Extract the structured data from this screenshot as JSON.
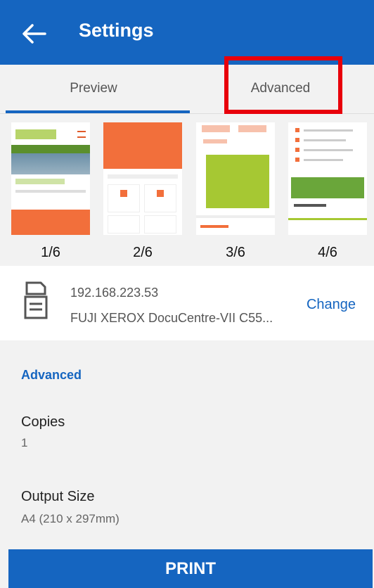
{
  "appbar": {
    "title": "Settings",
    "back_icon": "arrow-left-icon"
  },
  "tabs": [
    {
      "label": "Preview",
      "active": true
    },
    {
      "label": "Advanced",
      "active": false
    }
  ],
  "pages": [
    "1/6",
    "2/6",
    "3/6",
    "4/6"
  ],
  "printer": {
    "ip": "192.168.223.53",
    "model": "FUJI XEROX DocuCentre-VII C55...",
    "change_label": "Change",
    "icon": "printer-icon"
  },
  "advanced": {
    "section_title": "Advanced",
    "copies_label": "Copies",
    "copies_value": "1",
    "output_size_label": "Output Size",
    "output_size_value": "A4 (210 x 297mm)"
  },
  "print_button": {
    "label": "PRINT"
  },
  "colors": {
    "primary": "#1565c0",
    "highlight": "#e8000b",
    "thumb_orange": "#f26f3b",
    "thumb_green": "#a6c833"
  }
}
